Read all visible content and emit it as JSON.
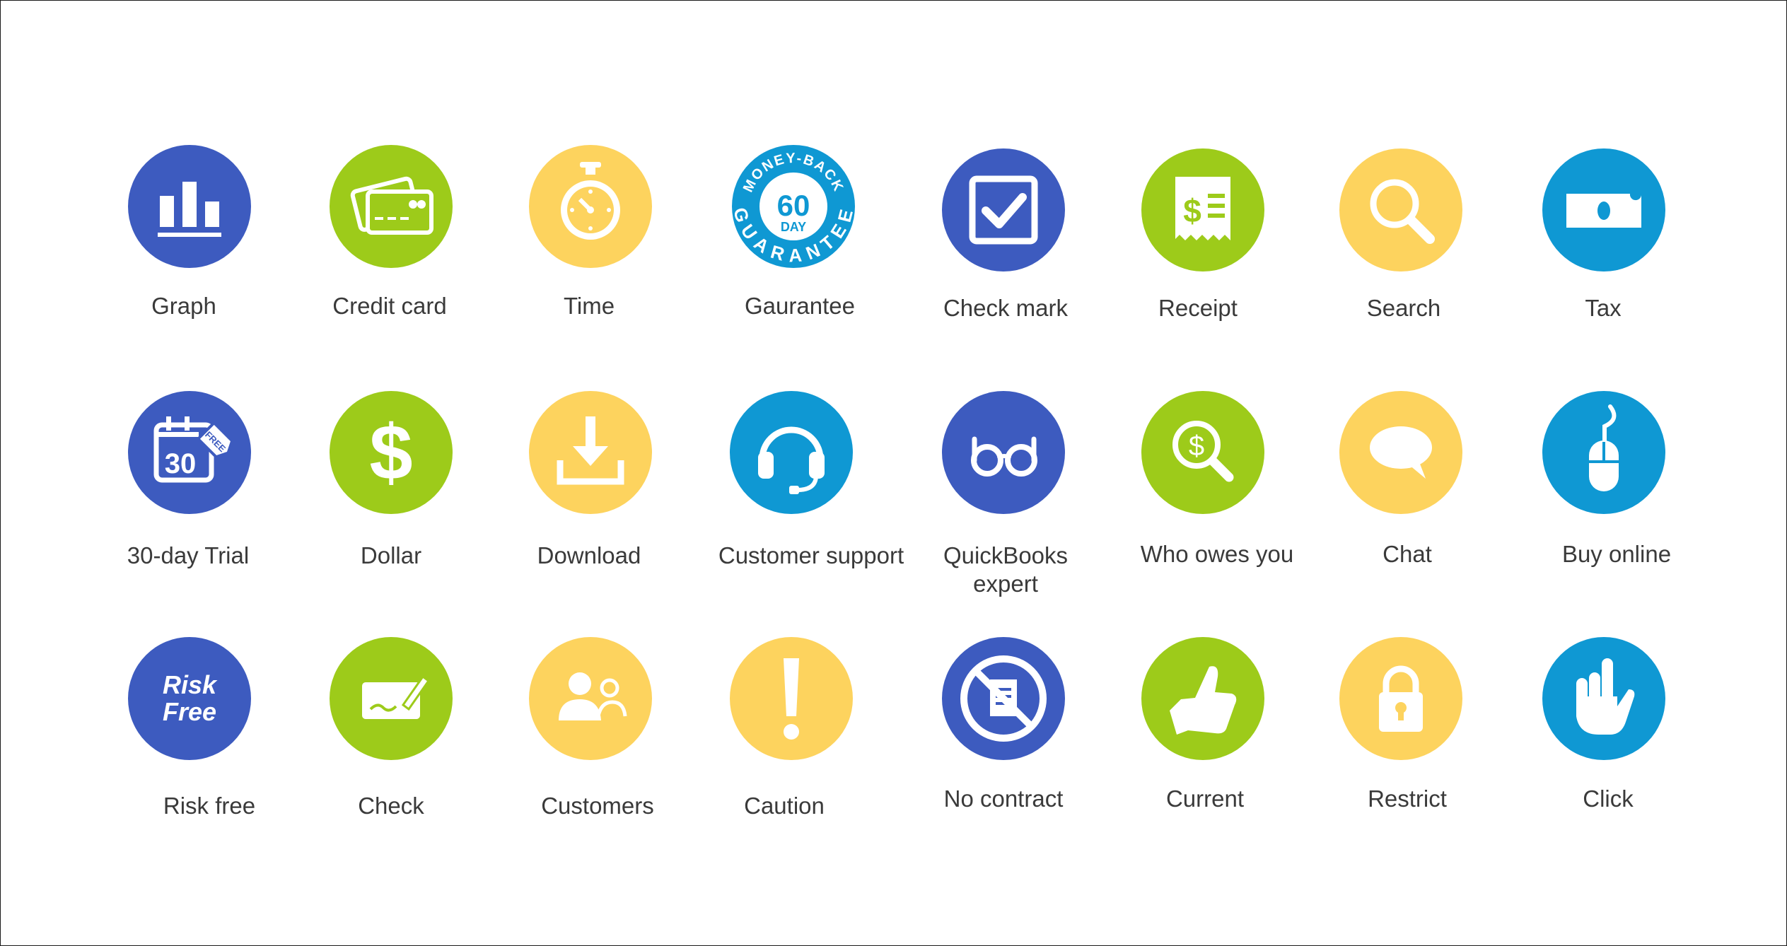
{
  "colors": {
    "blue_dark": "#3d5bbf",
    "green": "#9dcb1a",
    "yellow": "#fdd35e",
    "blue_light": "#0f98d3"
  },
  "icons": [
    {
      "label": "Graph",
      "icon": "bar-chart-icon",
      "color": "#3d5bbf"
    },
    {
      "label": "Credit card",
      "icon": "credit-card-icon",
      "color": "#9dcb1a"
    },
    {
      "label": "Time",
      "icon": "stopwatch-icon",
      "color": "#fdd35e"
    },
    {
      "label": "Gaurantee",
      "icon": "money-back-guarantee-icon",
      "color": "#0f98d3",
      "badge": {
        "top": "MONEY-BACK",
        "number": "60",
        "unit": "DAY",
        "bottom": "GUARANTEE"
      }
    },
    {
      "label": "Check mark",
      "icon": "checkbox-icon",
      "color": "#3d5bbf"
    },
    {
      "label": "Receipt",
      "icon": "receipt-icon",
      "color": "#9dcb1a"
    },
    {
      "label": "Search",
      "icon": "magnifier-icon",
      "color": "#fdd35e"
    },
    {
      "label": "Tax",
      "icon": "bitten-bill-icon",
      "color": "#0f98d3"
    },
    {
      "label": "30-day Trial",
      "icon": "calendar-free-tag-icon",
      "color": "#3d5bbf",
      "badge": {
        "number": "30",
        "tag": "FREE"
      }
    },
    {
      "label": "Dollar",
      "icon": "dollar-icon",
      "color": "#9dcb1a"
    },
    {
      "label": "Download",
      "icon": "download-icon",
      "color": "#fdd35e"
    },
    {
      "label": "Customer support",
      "icon": "headset-icon",
      "color": "#0f98d3"
    },
    {
      "label": "QuickBooks\nexpert",
      "icon": "glasses-icon",
      "color": "#3d5bbf"
    },
    {
      "label": "Who owes you",
      "icon": "dollar-magnifier-icon",
      "color": "#9dcb1a"
    },
    {
      "label": "Chat",
      "icon": "speech-bubble-icon",
      "color": "#fdd35e"
    },
    {
      "label": "Buy online",
      "icon": "mouse-icon",
      "color": "#0f98d3"
    },
    {
      "label": "Risk free",
      "icon": "risk-free-icon",
      "color": "#3d5bbf",
      "badge": {
        "line1": "Risk",
        "line2": "Free"
      }
    },
    {
      "label": "Check",
      "icon": "check-sign-icon",
      "color": "#9dcb1a"
    },
    {
      "label": "Customers",
      "icon": "people-icon",
      "color": "#fdd35e"
    },
    {
      "label": "Caution",
      "icon": "exclamation-icon",
      "color": "#fdd35e"
    },
    {
      "label": "No contract",
      "icon": "no-contract-icon",
      "color": "#3d5bbf"
    },
    {
      "label": "Current",
      "icon": "thumbs-up-icon",
      "color": "#9dcb1a"
    },
    {
      "label": "Restrict",
      "icon": "padlock-icon",
      "color": "#fdd35e"
    },
    {
      "label": "Click",
      "icon": "pointing-hand-icon",
      "color": "#0f98d3"
    }
  ]
}
